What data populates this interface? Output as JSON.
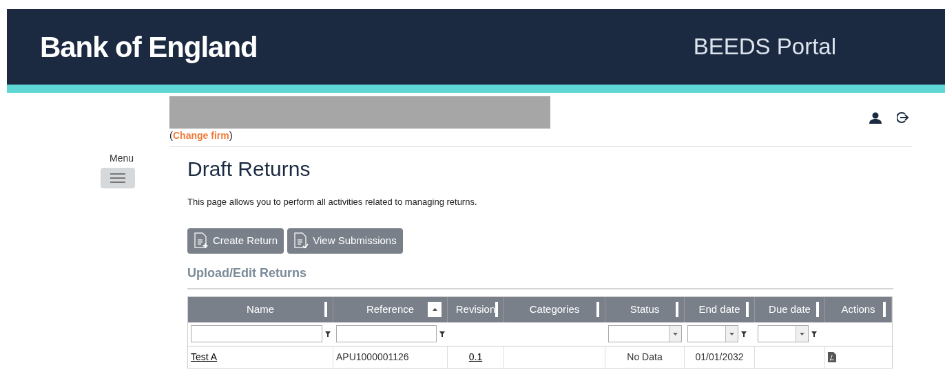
{
  "header": {
    "logo": "Bank of England",
    "portal": "BEEDS Portal"
  },
  "firm": {
    "open_paren": "(",
    "link": "Change firm",
    "close_paren": ")"
  },
  "menu": {
    "label": "Menu"
  },
  "page": {
    "title": "Draft Returns",
    "description": "This page allows you to perform all activities related to managing returns."
  },
  "buttons": [
    {
      "label": "Create Return",
      "kind": "create"
    },
    {
      "label": "View Submissions",
      "kind": "view"
    }
  ],
  "section": {
    "title": "Upload/Edit Returns"
  },
  "table": {
    "columns": [
      {
        "label": "Name",
        "sorted": false,
        "filter": {
          "kind": "text"
        }
      },
      {
        "label": "Reference",
        "sorted": true,
        "filter": {
          "kind": "text"
        }
      },
      {
        "label": "Revision",
        "sorted": false
      },
      {
        "label": "Categories",
        "sorted": false
      },
      {
        "label": "Status",
        "sorted": false,
        "filter": {
          "kind": "select"
        }
      },
      {
        "label": "End date",
        "sorted": false,
        "filter": {
          "kind": "select_funnel"
        }
      },
      {
        "label": "Due date",
        "sorted": false,
        "filter": {
          "kind": "select_funnel"
        }
      },
      {
        "label": "Actions",
        "sorted": false
      }
    ],
    "rows": [
      {
        "cells": [
          {
            "text": "Test A",
            "kind": "link"
          },
          {
            "text": "APU1000001126",
            "kind": "text"
          },
          {
            "text": "0.1",
            "kind": "link-center"
          },
          {
            "kind": "empty"
          },
          {
            "text": "No Data",
            "kind": "center"
          },
          {
            "text": "01/01/2032",
            "kind": "center"
          },
          {
            "kind": "empty"
          },
          {
            "kind": "pdf"
          }
        ]
      }
    ]
  }
}
